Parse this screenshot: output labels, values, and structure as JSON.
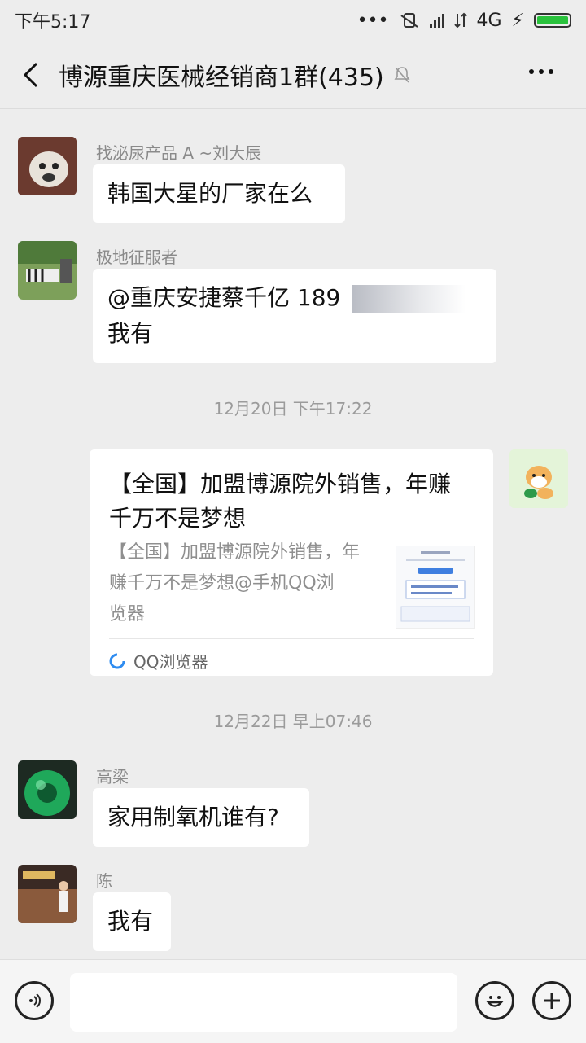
{
  "status_bar": {
    "time": "下午5:17",
    "network": "4G",
    "icons": [
      "more-dots-icon",
      "vibrate-icon",
      "signal-icon",
      "data-icon",
      "charging-icon",
      "battery-icon"
    ]
  },
  "header": {
    "title": "博源重庆医械经销商1群(435)",
    "icons": [
      "back-icon",
      "mute-icon",
      "more-icon"
    ]
  },
  "messages": [
    {
      "sender": "找泌尿产品 A ~刘大辰",
      "text": "韩国大星的厂家在么"
    },
    {
      "sender": "极地征服者",
      "text_line1": "@重庆安捷蔡千亿 189",
      "text_line2": "我有"
    },
    {
      "sender": "高梁",
      "text": "家用制氧机谁有?"
    },
    {
      "sender": "陈",
      "text": "我有"
    }
  ],
  "timestamps": [
    "12月20日 下午17:22",
    "12月22日 早上07:46"
  ],
  "shared_card": {
    "title_line1": "【全国】加盟博源院外销售，年赚",
    "title_line2": "千万不是梦想",
    "desc_line1": "【全国】加盟博源院外销售，年",
    "desc_line2": "赚千万不是梦想@手机QQ浏",
    "desc_line3": "览器",
    "source": "QQ浏览器"
  },
  "input_bar": {
    "placeholder": "",
    "icons": [
      "voice-icon",
      "emoji-icon",
      "plus-icon"
    ]
  },
  "colors": {
    "background": "#ededed",
    "bubble": "#ffffff",
    "battery": "#29c23c",
    "link_blue": "#5a6f9a"
  }
}
